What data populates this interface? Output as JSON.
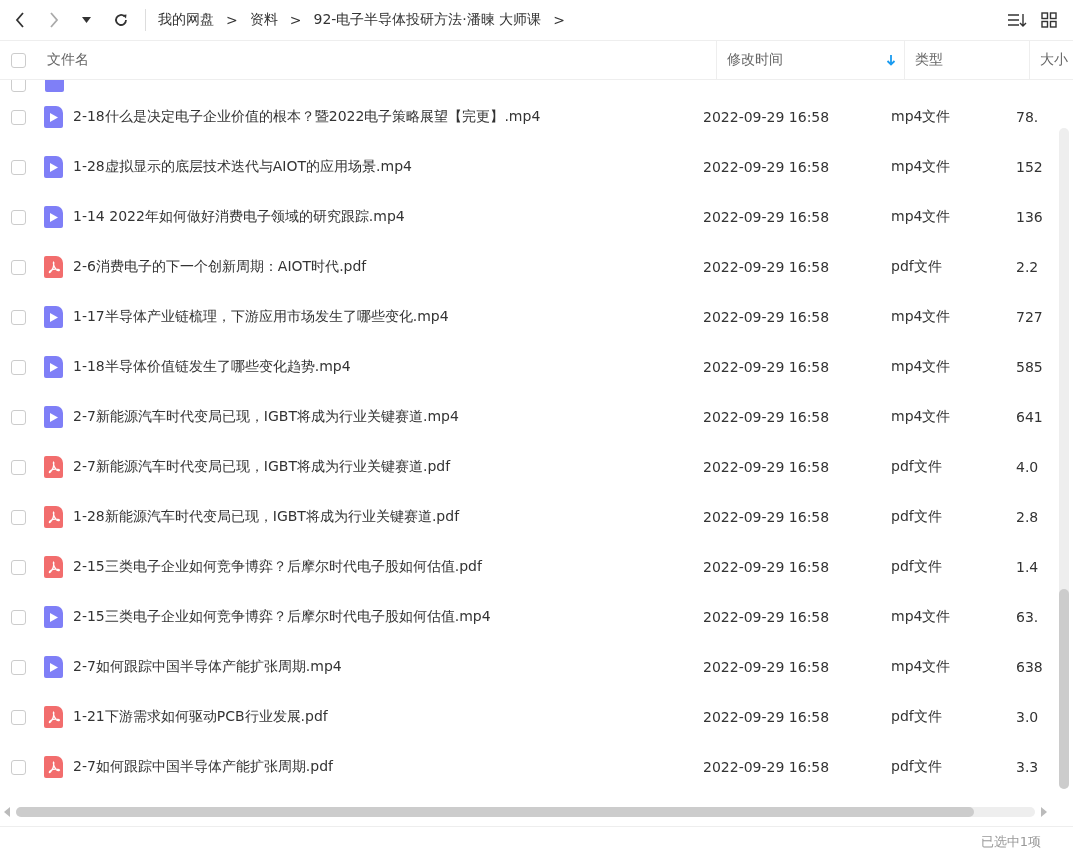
{
  "toolbar": {
    "breadcrumbs": [
      "我的网盘",
      "资料",
      "92-电子半导体投研方法·潘暕  大师课"
    ],
    "separator": ">"
  },
  "table": {
    "columns": [
      {
        "label": "文件名",
        "sorted": false
      },
      {
        "label": "修改时间",
        "sorted": true
      },
      {
        "label": "类型",
        "sorted": false
      },
      {
        "label": "大小",
        "sorted": false
      }
    ],
    "all_checked": false,
    "partial_row": {
      "kind": "mp4",
      "checked": false
    },
    "rows": [
      {
        "kind": "mp4",
        "name": "2-18什么是决定电子企业价值的根本？暨2022电子策略展望【完更】.mp4",
        "modified": "2022-09-29 16:58",
        "type": "mp4文件",
        "size": "78.",
        "checked": false
      },
      {
        "kind": "mp4",
        "name": "1-28虚拟显示的底层技术迭代与AIOT的应用场景.mp4",
        "modified": "2022-09-29 16:58",
        "type": "mp4文件",
        "size": "152",
        "checked": false
      },
      {
        "kind": "mp4",
        "name": "1-14 2022年如何做好消费电子领域的研究跟踪.mp4",
        "modified": "2022-09-29 16:58",
        "type": "mp4文件",
        "size": "136",
        "checked": false
      },
      {
        "kind": "pdf",
        "name": "2-6消费电子的下一个创新周期：AIOT时代.pdf",
        "modified": "2022-09-29 16:58",
        "type": "pdf文件",
        "size": "2.2",
        "checked": false
      },
      {
        "kind": "mp4",
        "name": "1-17半导体产业链梳理，下游应用市场发生了哪些变化.mp4",
        "modified": "2022-09-29 16:58",
        "type": "mp4文件",
        "size": "727",
        "checked": false
      },
      {
        "kind": "mp4",
        "name": "1-18半导体价值链发生了哪些变化趋势.mp4",
        "modified": "2022-09-29 16:58",
        "type": "mp4文件",
        "size": "585",
        "checked": false
      },
      {
        "kind": "mp4",
        "name": "2-7新能源汽车时代变局已现，IGBT将成为行业关键赛道.mp4",
        "modified": "2022-09-29 16:58",
        "type": "mp4文件",
        "size": "641",
        "checked": false
      },
      {
        "kind": "pdf",
        "name": "2-7新能源汽车时代变局已现，IGBT将成为行业关键赛道.pdf",
        "modified": "2022-09-29 16:58",
        "type": "pdf文件",
        "size": "4.0",
        "checked": false
      },
      {
        "kind": "pdf",
        "name": "1-28新能源汽车时代变局已现，IGBT将成为行业关键赛道.pdf",
        "modified": "2022-09-29 16:58",
        "type": "pdf文件",
        "size": "2.8",
        "checked": false
      },
      {
        "kind": "pdf",
        "name": "2-15三类电子企业如何竞争博弈？后摩尔时代电子股如何估值.pdf",
        "modified": "2022-09-29 16:58",
        "type": "pdf文件",
        "size": "1.4",
        "checked": false
      },
      {
        "kind": "mp4",
        "name": "2-15三类电子企业如何竞争博弈？后摩尔时代电子股如何估值.mp4",
        "modified": "2022-09-29 16:58",
        "type": "mp4文件",
        "size": "63.",
        "checked": false
      },
      {
        "kind": "mp4",
        "name": "2-7如何跟踪中国半导体产能扩张周期.mp4",
        "modified": "2022-09-29 16:58",
        "type": "mp4文件",
        "size": "638",
        "checked": false
      },
      {
        "kind": "pdf",
        "name": "1-21下游需求如何驱动PCB行业发展.pdf",
        "modified": "2022-09-29 16:58",
        "type": "pdf文件",
        "size": "3.0",
        "checked": false
      },
      {
        "kind": "pdf",
        "name": "2-7如何跟踪中国半导体产能扩张周期.pdf",
        "modified": "2022-09-29 16:58",
        "type": "pdf文件",
        "size": "3.3",
        "checked": false
      }
    ]
  },
  "status_bar": {
    "selection": "已选中1项"
  }
}
